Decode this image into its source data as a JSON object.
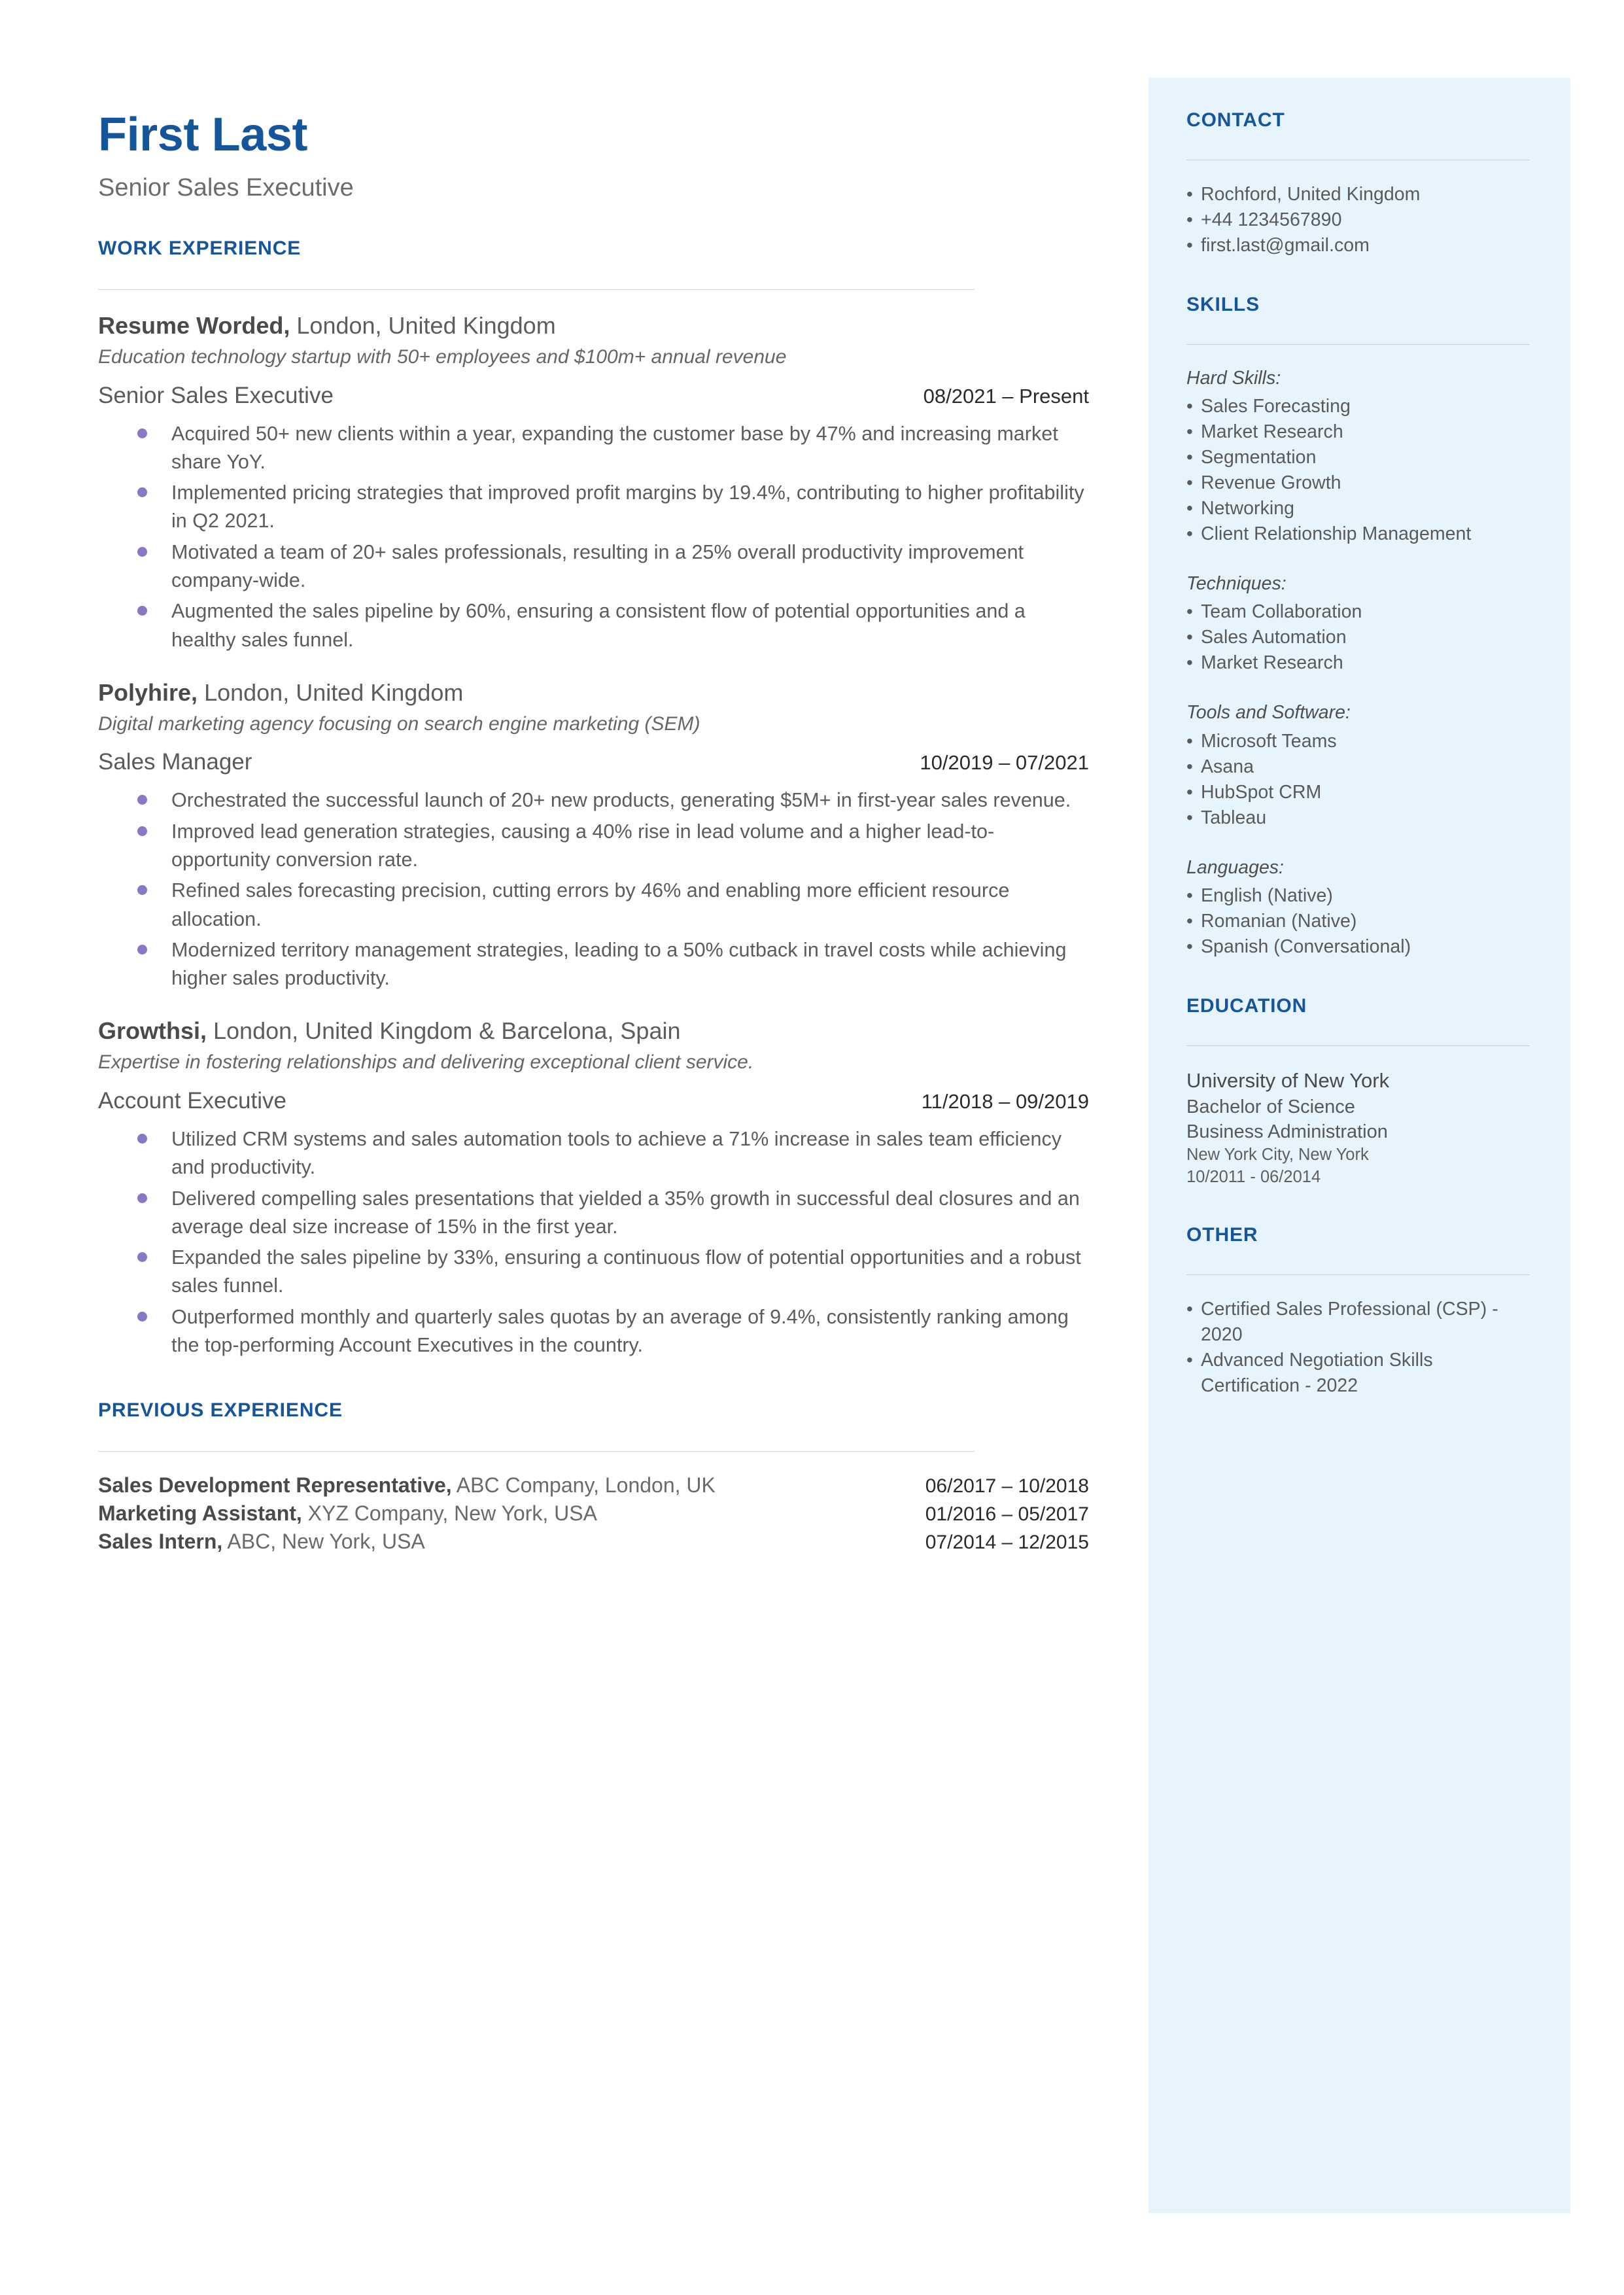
{
  "header": {
    "name": "First Last",
    "title": "Senior Sales Executive"
  },
  "sections": {
    "work_experience": "WORK EXPERIENCE",
    "previous_experience": "PREVIOUS EXPERIENCE",
    "contact": "CONTACT",
    "skills": "SKILLS",
    "education": "EDUCATION",
    "other": "OTHER"
  },
  "jobs": [
    {
      "company": "Resume Worded,",
      "location": " London, United Kingdom",
      "description": "Education technology startup with 50+ employees and $100m+ annual revenue",
      "role": "Senior Sales Executive",
      "dates": "08/2021 – Present",
      "bullets": [
        "Acquired 50+ new clients within a year, expanding the customer base by 47% and increasing market share YoY.",
        "Implemented pricing strategies that improved profit margins by 19.4%, contributing to higher profitability in Q2 2021.",
        "Motivated a team of 20+ sales professionals, resulting in a 25% overall productivity improvement company-wide.",
        "Augmented the sales pipeline by 60%, ensuring a consistent flow of potential opportunities and a healthy sales funnel."
      ]
    },
    {
      "company": "Polyhire,",
      "location": " London, United Kingdom",
      "description": "Digital marketing agency focusing on search engine marketing (SEM)",
      "role": "Sales Manager",
      "dates": "10/2019 – 07/2021",
      "bullets": [
        "Orchestrated the successful launch of 20+ new products, generating $5M+ in first-year sales revenue.",
        "Improved lead generation strategies, causing a 40% rise in lead volume and a higher lead-to-opportunity conversion rate.",
        "Refined sales forecasting precision, cutting errors by 46% and enabling more efficient resource allocation.",
        "Modernized territory management strategies, leading to a 50% cutback in travel costs while achieving higher sales productivity."
      ]
    },
    {
      "company": "Growthsi,",
      "location": " London, United Kingdom & Barcelona, Spain",
      "description": "Expertise in fostering relationships and delivering exceptional client service.",
      "role": "Account Executive",
      "dates": "11/2018 – 09/2019",
      "bullets": [
        "Utilized CRM systems and sales automation tools to achieve a 71% increase in sales team efficiency and productivity.",
        "Delivered compelling sales presentations that yielded a 35% growth in successful deal closures and an average deal size increase of 15% in the first year.",
        "Expanded the sales pipeline by 33%, ensuring a continuous flow of potential opportunities and a robust sales funnel.",
        "Outperformed monthly and quarterly sales quotas by an average of 9.4%, consistently ranking among the top-performing Account Executives in the country."
      ]
    }
  ],
  "previous_experience": [
    {
      "role": "Sales Development Representative,",
      "detail": " ABC Company, London, UK",
      "dates": "06/2017 – 10/2018"
    },
    {
      "role": "Marketing Assistant,",
      "detail": " XYZ Company, New York, USA",
      "dates": "01/2016 – 05/2017"
    },
    {
      "role": "Sales Intern,",
      "detail": " ABC, New York, USA",
      "dates": "07/2014 – 12/2015"
    }
  ],
  "contact": {
    "items": [
      "Rochford, United Kingdom",
      "+44 1234567890",
      "first.last@gmail.com"
    ]
  },
  "skills": {
    "groups": [
      {
        "label": "Hard Skills:",
        "items": [
          "Sales Forecasting",
          "Market Research",
          "Segmentation",
          "Revenue Growth",
          "Networking",
          "Client Relationship Management"
        ]
      },
      {
        "label": "Techniques:",
        "items": [
          "Team Collaboration",
          "Sales Automation",
          "Market Research"
        ]
      },
      {
        "label": "Tools and Software:",
        "items": [
          "Microsoft Teams",
          "Asana",
          "HubSpot CRM",
          "Tableau"
        ]
      },
      {
        "label": "Languages:",
        "items": [
          "English (Native)",
          "Romanian (Native)",
          "Spanish (Conversational)"
        ]
      }
    ]
  },
  "education": {
    "school": "University of New York",
    "degree": "Bachelor of Science",
    "field": "Business Administration",
    "location": "New York City, New York",
    "dates": "10/2011 - 06/2014"
  },
  "other": {
    "items": [
      "Certified Sales Professional (CSP) - 2020",
      "Advanced Negotiation Skills Certification - 2022"
    ]
  },
  "colors": {
    "accent": "#14559c",
    "sidebar_bg": "#e7f3fd",
    "bullet": "#8878c3",
    "body_text": "#5a5a5a"
  }
}
